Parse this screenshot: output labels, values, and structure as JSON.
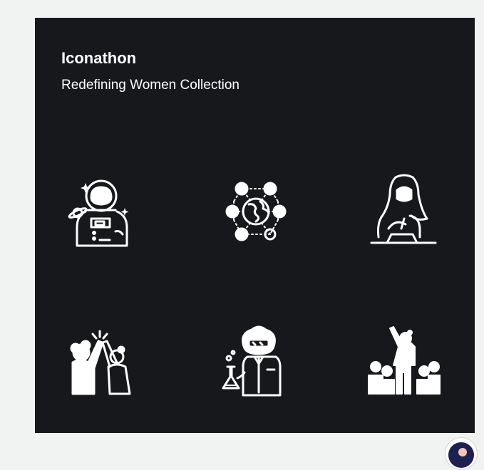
{
  "card": {
    "title": "Iconathon",
    "subtitle": "Redefining Women Collection"
  },
  "icons": [
    {
      "name": "astronaut-icon"
    },
    {
      "name": "global-network-icon"
    },
    {
      "name": "hijab-woman-writing-icon"
    },
    {
      "name": "high-five-icon"
    },
    {
      "name": "scientist-icon"
    },
    {
      "name": "leader-crowd-icon"
    }
  ],
  "colors": {
    "page_background": "#f1f2f2",
    "card_background": "#17181c",
    "foreground": "#ffffff"
  }
}
